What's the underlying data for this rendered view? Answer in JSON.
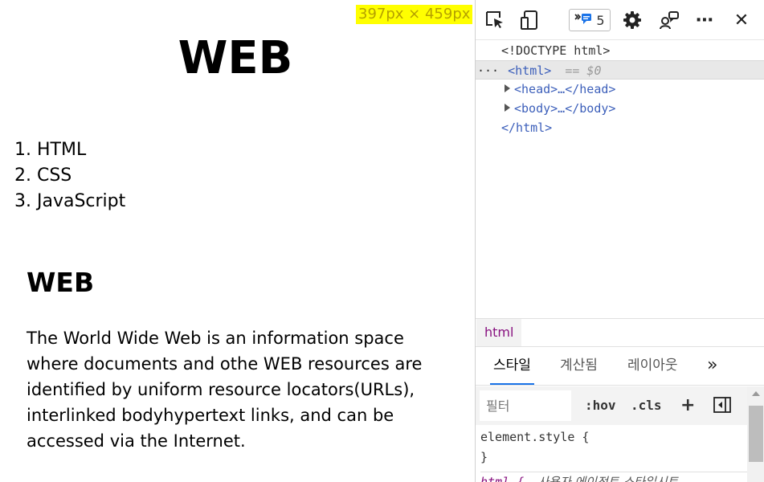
{
  "viewport": {
    "size_badge": "397px × 459px",
    "title": "WEB",
    "list_items": [
      "1. HTML",
      "2. CSS",
      "3. JavaScript"
    ],
    "section_heading": "WEB",
    "section_body": "The World Wide Web is an information space where documents and othe WEB resources are identified by uniform resource locators(URLs), interlinked bodyhypertext links, and can be accessed via the Internet."
  },
  "devtools": {
    "toolbar": {
      "issues_count": "5",
      "more_label": "⋯",
      "close_label": "✕"
    },
    "elements": {
      "doctype": "<!DOCTYPE html>",
      "html_open": "<html>",
      "selected_marker": "== $0",
      "row_dots": "···",
      "head": "<head>…</head>",
      "body": "<body>…</body>",
      "html_close": "</html>"
    },
    "breadcrumb": "html",
    "tabs": [
      "스타일",
      "계산됨",
      "레이아웃",
      "»"
    ],
    "filter": {
      "placeholder": "필터",
      "hov": ":hov",
      "cls": ".cls",
      "add": "+"
    },
    "styles": {
      "element_style_open": "element.style {",
      "element_style_close": "}",
      "next_rule_selector": "html {",
      "next_rule_source": "사용자 에이전트 스타일시트"
    }
  },
  "colors": {
    "badge_bg": "#ffff00",
    "tag_blue": "#3c5fba",
    "active_tab_underline": "#1a73e8",
    "breadcrumb_text": "#881280"
  },
  "icons": [
    "inspect-element-icon",
    "device-toggle-icon",
    "issues-icon",
    "settings-gear-icon",
    "customize-icon",
    "more-icon",
    "close-icon",
    "toggle-sidebar-icon"
  ]
}
